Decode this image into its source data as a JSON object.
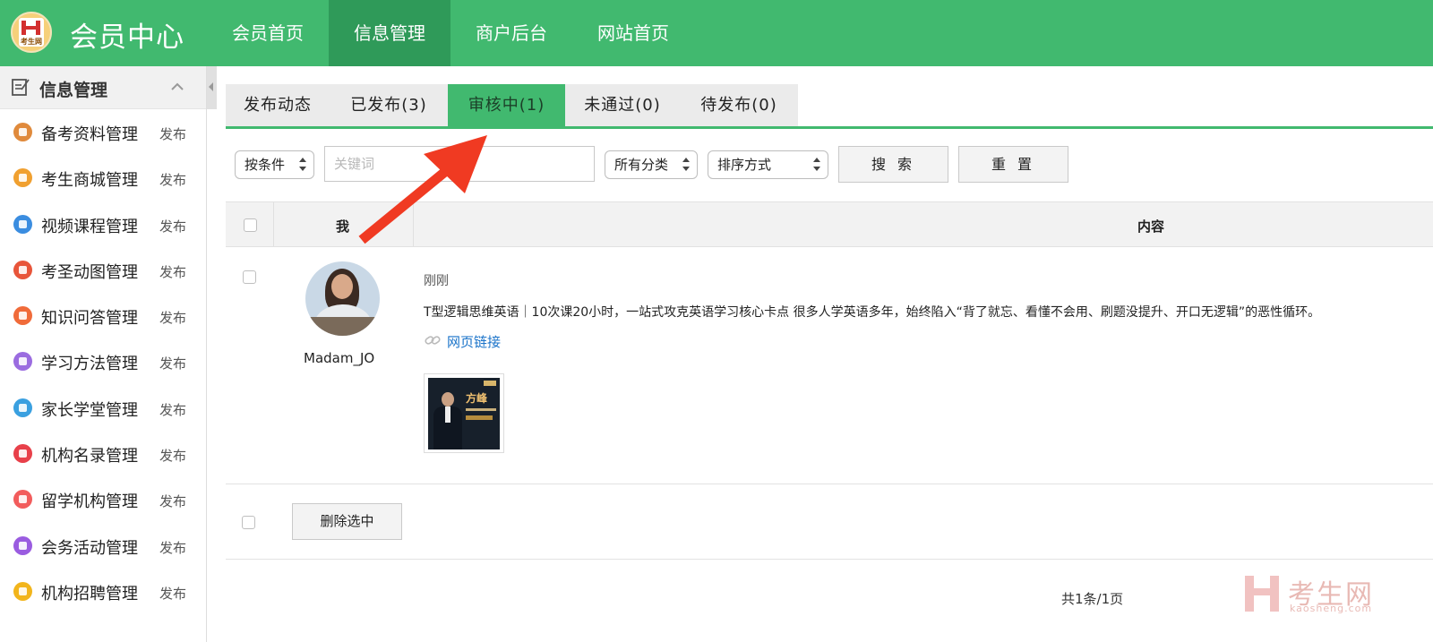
{
  "header": {
    "logo_text": "考生网",
    "title": "会员中心",
    "nav": [
      {
        "label": "会员首页"
      },
      {
        "label": "信息管理"
      },
      {
        "label": "商户后台"
      },
      {
        "label": "网站首页"
      }
    ],
    "active_nav": "信息管理",
    "color": "#41b96f",
    "active_color": "#2f9a59"
  },
  "sidebar": {
    "heading": "信息管理",
    "publish_label": "发布",
    "items": [
      {
        "label": "备考资料管理",
        "icon": "books-icon",
        "color": "#e08a3c"
      },
      {
        "label": "考生商城管理",
        "icon": "cart-icon",
        "color": "#f0a030"
      },
      {
        "label": "视频课程管理",
        "icon": "video-icon",
        "color": "#3b8de0"
      },
      {
        "label": "考圣动图管理",
        "icon": "pen-icon",
        "color": "#e8553a"
      },
      {
        "label": "知识问答管理",
        "icon": "question-icon",
        "color": "#f06b3a"
      },
      {
        "label": "学习方法管理",
        "icon": "chart-bars-icon",
        "color": "#9b6ce0"
      },
      {
        "label": "家长学堂管理",
        "icon": "graduation-cap-icon",
        "color": "#3aa0e0"
      },
      {
        "label": "机构名录管理",
        "icon": "building-icon",
        "color": "#e8404a"
      },
      {
        "label": "留学机构管理",
        "icon": "plane-icon",
        "color": "#f25c5c"
      },
      {
        "label": "会务活动管理",
        "icon": "flag-icon",
        "color": "#9a5ce0"
      },
      {
        "label": "机构招聘管理",
        "icon": "recruit-icon",
        "color": "#f2b51c"
      }
    ]
  },
  "tabs": [
    {
      "label": "发布动态"
    },
    {
      "label": "已发布(3)"
    },
    {
      "label": "审核中(1)"
    },
    {
      "label": "未通过(0)"
    },
    {
      "label": "待发布(0)"
    }
  ],
  "active_tab": "审核中(1)",
  "filters": {
    "condition": "按条件",
    "keyword_placeholder": "关键词",
    "category": "所有分类",
    "sort": "排序方式",
    "search_button": "搜 索",
    "reset_button": "重 置"
  },
  "table": {
    "col_me": "我",
    "col_content": "内容",
    "rows": [
      {
        "username": "Madam_JO",
        "time": "刚刚",
        "text": "T型逻辑思维英语｜10次课20小时，一站式攻克英语学习核心卡点 很多人学英语多年，始终陷入“背了就忘、看懂不会用、刷题没提升、开口无逻辑”的恶性循环。",
        "link_label": "网页链接",
        "thumb_title": "方峰"
      }
    ]
  },
  "bulk": {
    "delete_selected": "删除选中"
  },
  "pagination": "共1条/1页",
  "watermark": {
    "brand": "考生网",
    "domain": "kaosheng.com"
  },
  "annotation": {
    "arrow_color": "#f03a22"
  }
}
